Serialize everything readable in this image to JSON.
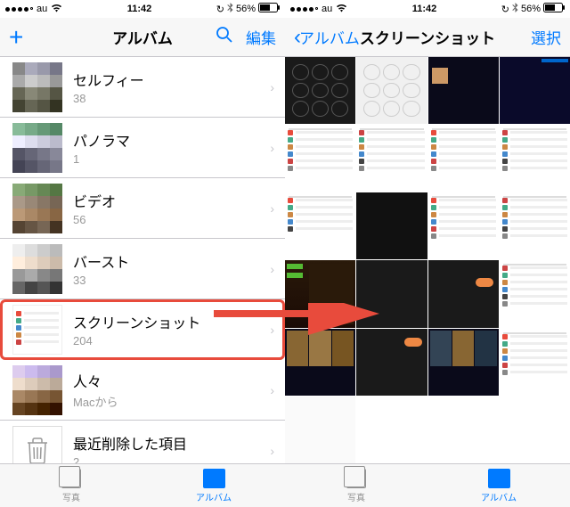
{
  "status": {
    "carrier": "au",
    "time": "11:42",
    "battery": "56%"
  },
  "left": {
    "title": "アルバム",
    "edit": "編集",
    "albums": [
      {
        "name": "セルフィー",
        "count": "38"
      },
      {
        "name": "パノラマ",
        "count": "1"
      },
      {
        "name": "ビデオ",
        "count": "56"
      },
      {
        "name": "バースト",
        "count": "33"
      },
      {
        "name": "スクリーンショット",
        "count": "204"
      },
      {
        "name": "人々",
        "count": "Macから"
      },
      {
        "name": "最近削除した項目",
        "count": "2"
      }
    ]
  },
  "right": {
    "back": "アルバム",
    "title": "スクリーンショット",
    "select": "選択"
  },
  "tabs": {
    "photos": "写真",
    "albums": "アルバム"
  },
  "colors": {
    "accent": "#007aff",
    "highlight": "#e84b3c"
  }
}
